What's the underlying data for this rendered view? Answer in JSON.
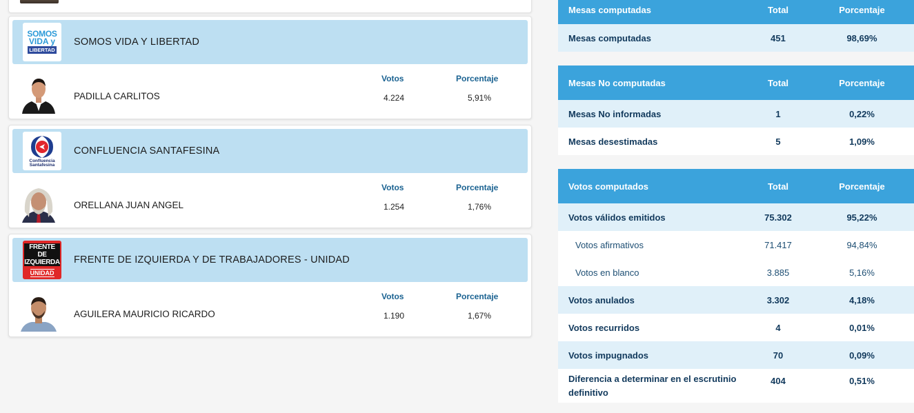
{
  "parties": [
    {
      "name": "SOMOS VIDA Y LIBERTAD",
      "logo_lines": [
        "SOMOS",
        "VIDA y",
        "LIBERTAD"
      ],
      "candidate": "PADILLA CARLITOS",
      "votes_label": "Votos",
      "pct_label": "Porcentaje",
      "votes": "4.224",
      "pct": "5,91%"
    },
    {
      "name": "CONFLUENCIA SANTAFESINA",
      "logo_lines": [
        "Confluencia",
        "Santafesina"
      ],
      "candidate": "ORELLANA JUAN ANGEL",
      "votes_label": "Votos",
      "pct_label": "Porcentaje",
      "votes": "1.254",
      "pct": "1,76%"
    },
    {
      "name": "FRENTE DE IZQUIERDA Y DE TRABAJADORES - UNIDAD",
      "logo_lines": [
        "FRENTE DE",
        "IZQUIERDA",
        "UNIDAD"
      ],
      "candidate": "AGUILERA MAURICIO RICARDO",
      "votes_label": "Votos",
      "pct_label": "Porcentaje",
      "votes": "1.190",
      "pct": "1,67%"
    }
  ],
  "mesas_computadas": {
    "header": [
      "Mesas computadas",
      "Total",
      "Porcentaje"
    ],
    "rows": [
      [
        "Mesas computadas",
        "451",
        "98,69%"
      ]
    ]
  },
  "mesas_no_computadas": {
    "header": [
      "Mesas No computadas",
      "Total",
      "Porcentaje"
    ],
    "rows": [
      [
        "Mesas No informadas",
        "1",
        "0,22%"
      ],
      [
        "Mesas desestimadas",
        "5",
        "1,09%"
      ]
    ]
  },
  "votos_computados": {
    "header": [
      "Votos computados",
      "Total",
      "Porcentaje"
    ],
    "rows": [
      [
        "Votos válidos emitidos",
        "75.302",
        "95,22%"
      ],
      [
        "Votos afirmativos",
        "71.417",
        "94,84%"
      ],
      [
        "Votos en blanco",
        "3.885",
        "5,16%"
      ],
      [
        "Votos anulados",
        "3.302",
        "4,18%"
      ],
      [
        "Votos recurridos",
        "4",
        "0,01%"
      ],
      [
        "Votos impugnados",
        "70",
        "0,09%"
      ],
      [
        "Diferencia a determinar en el escrutinio definitivo",
        "404",
        "0,51%"
      ]
    ]
  },
  "colors": {
    "header_blue": "#3ba3dc",
    "band_light_blue": "#bddff2",
    "row_light_blue": "#e0f0f9",
    "label_blue": "#1a6291"
  }
}
